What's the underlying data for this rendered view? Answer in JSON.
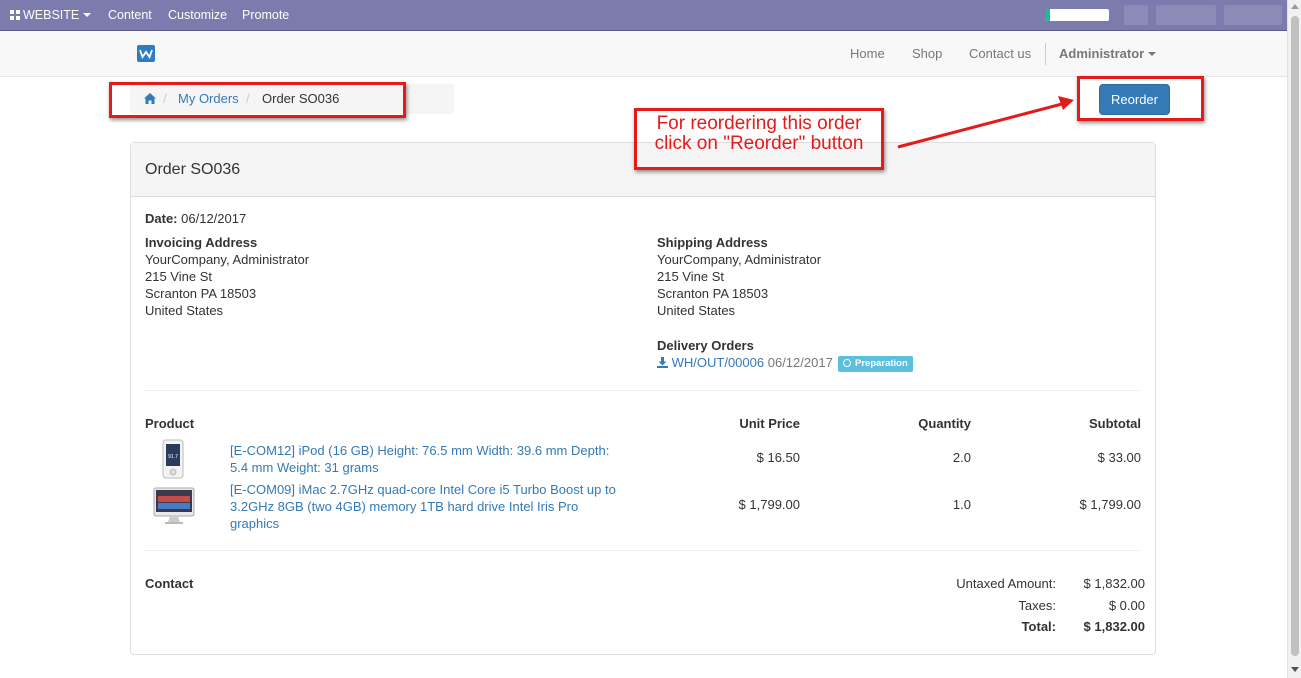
{
  "adminbar": {
    "website_label": "WEBSITE",
    "menu": [
      "Content",
      "Customize",
      "Promote"
    ],
    "progress_fraction": 0.06,
    "accent": "#7c7bad"
  },
  "navbar": {
    "links": [
      "Home",
      "Shop",
      "Contact us"
    ],
    "user": "Administrator"
  },
  "breadcrumb": {
    "items": [
      "My Orders",
      "Order SO036"
    ]
  },
  "annotation": {
    "line1": "For reordering this order",
    "line2": "click on \"Reorder\" button",
    "color": "#e31b1b"
  },
  "reorder_button": "Reorder",
  "order": {
    "title": "Order SO036",
    "date_label": "Date:",
    "date": "06/12/2017",
    "invoicing": {
      "heading": "Invoicing Address",
      "lines": [
        "YourCompany, Administrator",
        "215 Vine St",
        "Scranton PA 18503",
        "United States"
      ]
    },
    "shipping": {
      "heading": "Shipping Address",
      "lines": [
        "YourCompany, Administrator",
        "215 Vine St",
        "Scranton PA 18503",
        "United States"
      ]
    },
    "delivery": {
      "heading": "Delivery Orders",
      "ref": "WH/OUT/00006",
      "date": "06/12/2017",
      "status": "Preparation"
    },
    "columns": [
      "Product",
      "Unit Price",
      "Quantity",
      "Subtotal"
    ],
    "lines": [
      {
        "name_l1": "[E-COM12] iPod (16 GB) Height: 76.5 mm Width: 39.6 mm Depth:",
        "name_l2": "5.4 mm Weight: 31 grams",
        "unit_price": "$ 16.50",
        "quantity": "2.0",
        "subtotal": "$ 33.00"
      },
      {
        "name_l1": "[E-COM09] iMac 2.7GHz quad-core Intel Core i5 Turbo Boost up to",
        "name_l2": "3.2GHz 8GB (two 4GB) memory 1TB hard drive Intel Iris Pro",
        "name_l3": "graphics",
        "unit_price": "$ 1,799.00",
        "quantity": "1.0",
        "subtotal": "$ 1,799.00"
      }
    ],
    "contact_label": "Contact",
    "totals": {
      "untaxed_label": "Untaxed Amount:",
      "untaxed": "$ 1,832.00",
      "taxes_label": "Taxes:",
      "taxes": "$ 0.00",
      "total_label": "Total:",
      "total": "$ 1,832.00"
    }
  }
}
